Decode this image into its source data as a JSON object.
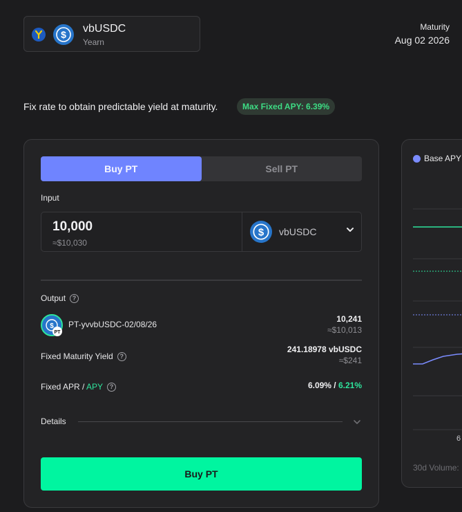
{
  "asset": {
    "name": "vbUSDC",
    "protocol": "Yearn",
    "protocol_icon": "yearn-icon",
    "token_icon": "usdc-icon"
  },
  "maturity": {
    "label": "Maturity",
    "date": "Aug 02 2026"
  },
  "tagline": "Fix rate to obtain predictable yield at maturity.",
  "badge": "Max Fixed APY: 6.39%",
  "tabs": [
    {
      "label": "Buy PT",
      "active": true
    },
    {
      "label": "Sell PT",
      "active": false
    }
  ],
  "input": {
    "label": "Input",
    "amount": "10,000",
    "fiat": "≈$10,030",
    "token": "vbUSDC"
  },
  "output": {
    "label": "Output",
    "token": "PT-yvvbUSDC-02/08/26",
    "badge": "PT",
    "amount": "10,241",
    "fiat": "≈$10,013"
  },
  "yield": {
    "label": "Fixed Maturity Yield",
    "value": "241.18978 vbUSDC",
    "fiat": "≈$241"
  },
  "apr": {
    "label_prefix": "Fixed APR / ",
    "label_suffix": "APY",
    "value_apr": "6.09% / ",
    "value_apy": "6.21%"
  },
  "details_label": "Details",
  "buy_button": "Buy PT",
  "chart": {
    "legend": "Base APY",
    "x_tick": "6",
    "volume_label": "30d Volume:"
  },
  "colors": {
    "accent": "#6f84ff",
    "primary_button": "#00f5a0",
    "green": "#2ee59d",
    "background": "#1c1c1e"
  }
}
